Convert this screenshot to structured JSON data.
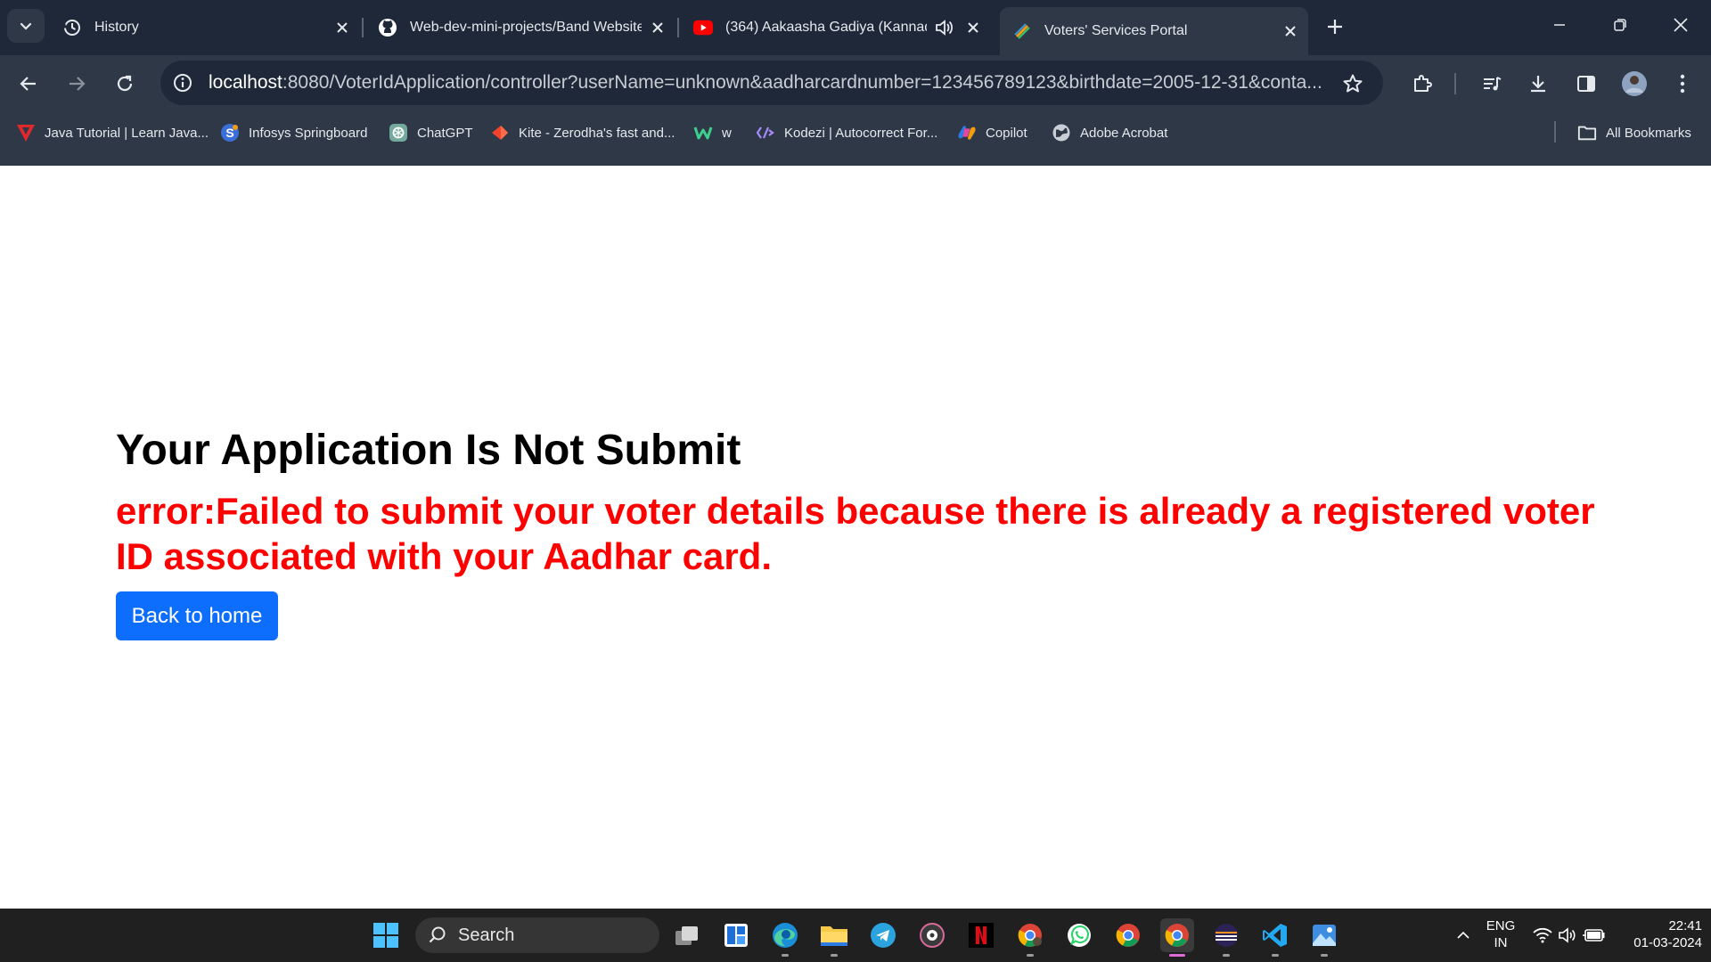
{
  "browser": {
    "tabs": [
      {
        "title": "History",
        "icon": "history-icon"
      },
      {
        "title": "Web-dev-mini-projects/Band Website",
        "icon": "github-icon"
      },
      {
        "title": "(364) Aakaasha Gadiya (Kannada)",
        "icon": "youtube-icon"
      },
      {
        "title": "Voters' Services Portal",
        "icon": "portal-favicon",
        "active": true
      }
    ],
    "url_host": "localhost",
    "url_rest": ":8080/VoterIdApplication/controller?userName=unknown&aadharcardnumber=123456789123&birthdate=2005-12-31&conta...",
    "bookmarks": [
      {
        "label": "Java Tutorial | Learn Java...",
        "icon": "tutorial-favicon"
      },
      {
        "label": "Infosys Springboard",
        "icon": "springboard-favicon"
      },
      {
        "label": "ChatGPT",
        "icon": "chatgpt-icon"
      },
      {
        "label": "Kite - Zerodha's fast and...",
        "icon": "kite-icon"
      },
      {
        "label": "w",
        "icon": "w-favicon"
      },
      {
        "label": "Kodezi | Autocorrect For...",
        "icon": "kodezi-icon"
      },
      {
        "label": "Copilot",
        "icon": "copilot-icon"
      },
      {
        "label": "Adobe Acrobat",
        "icon": "globe-icon"
      }
    ],
    "all_bookmarks_label": "All Bookmarks"
  },
  "page": {
    "heading": "Your Application Is Not Submit",
    "error": "error:Failed to submit your voter details because there is already a registered voter ID associated with your Aadhar card.",
    "back_button": "Back to home"
  },
  "taskbar": {
    "search_label": "Search",
    "language": "ENG",
    "region": "IN",
    "time": "22:41",
    "date": "01-03-2024"
  },
  "colors": {
    "error_text": "#ff0000",
    "button_bg": "#0d6efd",
    "browser_frame": "#1e2838",
    "toolbar": "#2e3847"
  }
}
